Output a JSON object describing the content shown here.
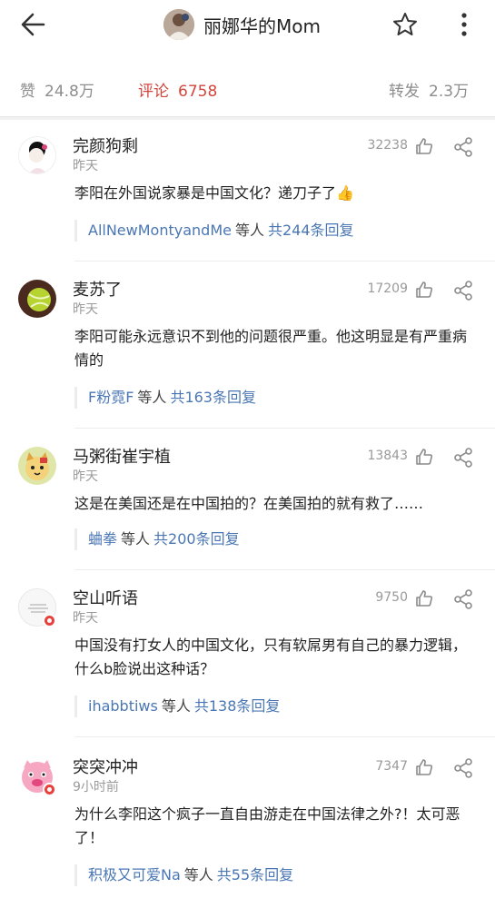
{
  "header": {
    "title": "丽娜华的Mom",
    "back_icon": "back-arrow-icon",
    "star_icon": "star-outline-icon",
    "more_icon": "more-vertical-icon"
  },
  "stats": {
    "likes_label": "赞",
    "likes_value": "24.8万",
    "comments_label": "评论",
    "comments_value": "6758",
    "reposts_label": "转发",
    "reposts_value": "2.3万",
    "active_color": "#d1463c"
  },
  "comments": [
    {
      "name": "完颜狗剩",
      "time": "昨天",
      "likes": "32238",
      "text": "李阳在外国说家暴是中国文化？递刀子了",
      "emoji": "👍",
      "reply_names": "AllNewMontyandMe",
      "reply_mid": "等人",
      "reply_count": "共244条回复"
    },
    {
      "name": "麦苏了",
      "time": "昨天",
      "likes": "17209",
      "text": "李阳可能永远意识不到他的问题很严重。他这明显是有严重病情的",
      "reply_names": "F粉霓F",
      "reply_mid": "等人",
      "reply_count": "共163条回复"
    },
    {
      "name": "马粥街崔宇植",
      "time": "昨天",
      "likes": "13843",
      "text": "这是在美国还是在中国拍的？在美国拍的就有救了……",
      "reply_names": "蛐拳",
      "reply_mid": "等人",
      "reply_count": "共200条回复"
    },
    {
      "name": "空山听语",
      "time": "昨天",
      "likes": "9750",
      "text": "中国没有打女人的中国文化，只有软屌男有自己的暴力逻辑，什么b脸说出这种话？",
      "reply_names": "ihabbtiws",
      "reply_mid": "等人",
      "reply_count": "共138条回复"
    },
    {
      "name": "突突冲冲",
      "time": "9小时前",
      "likes": "7347",
      "text": "为什么李阳这个疯子一直自由游走在中国法律之外?！太可恶了！",
      "reply_names": "积极又可爱Na",
      "reply_mid": "等人",
      "reply_count": "共55条回复"
    }
  ],
  "icons": {
    "like": "thumbs-up-icon",
    "share": "share-icon",
    "verified": "verified-badge-icon"
  },
  "colors": {
    "link": "#4a77b4",
    "muted": "#9a9a9a",
    "badge": "#e8413d"
  }
}
